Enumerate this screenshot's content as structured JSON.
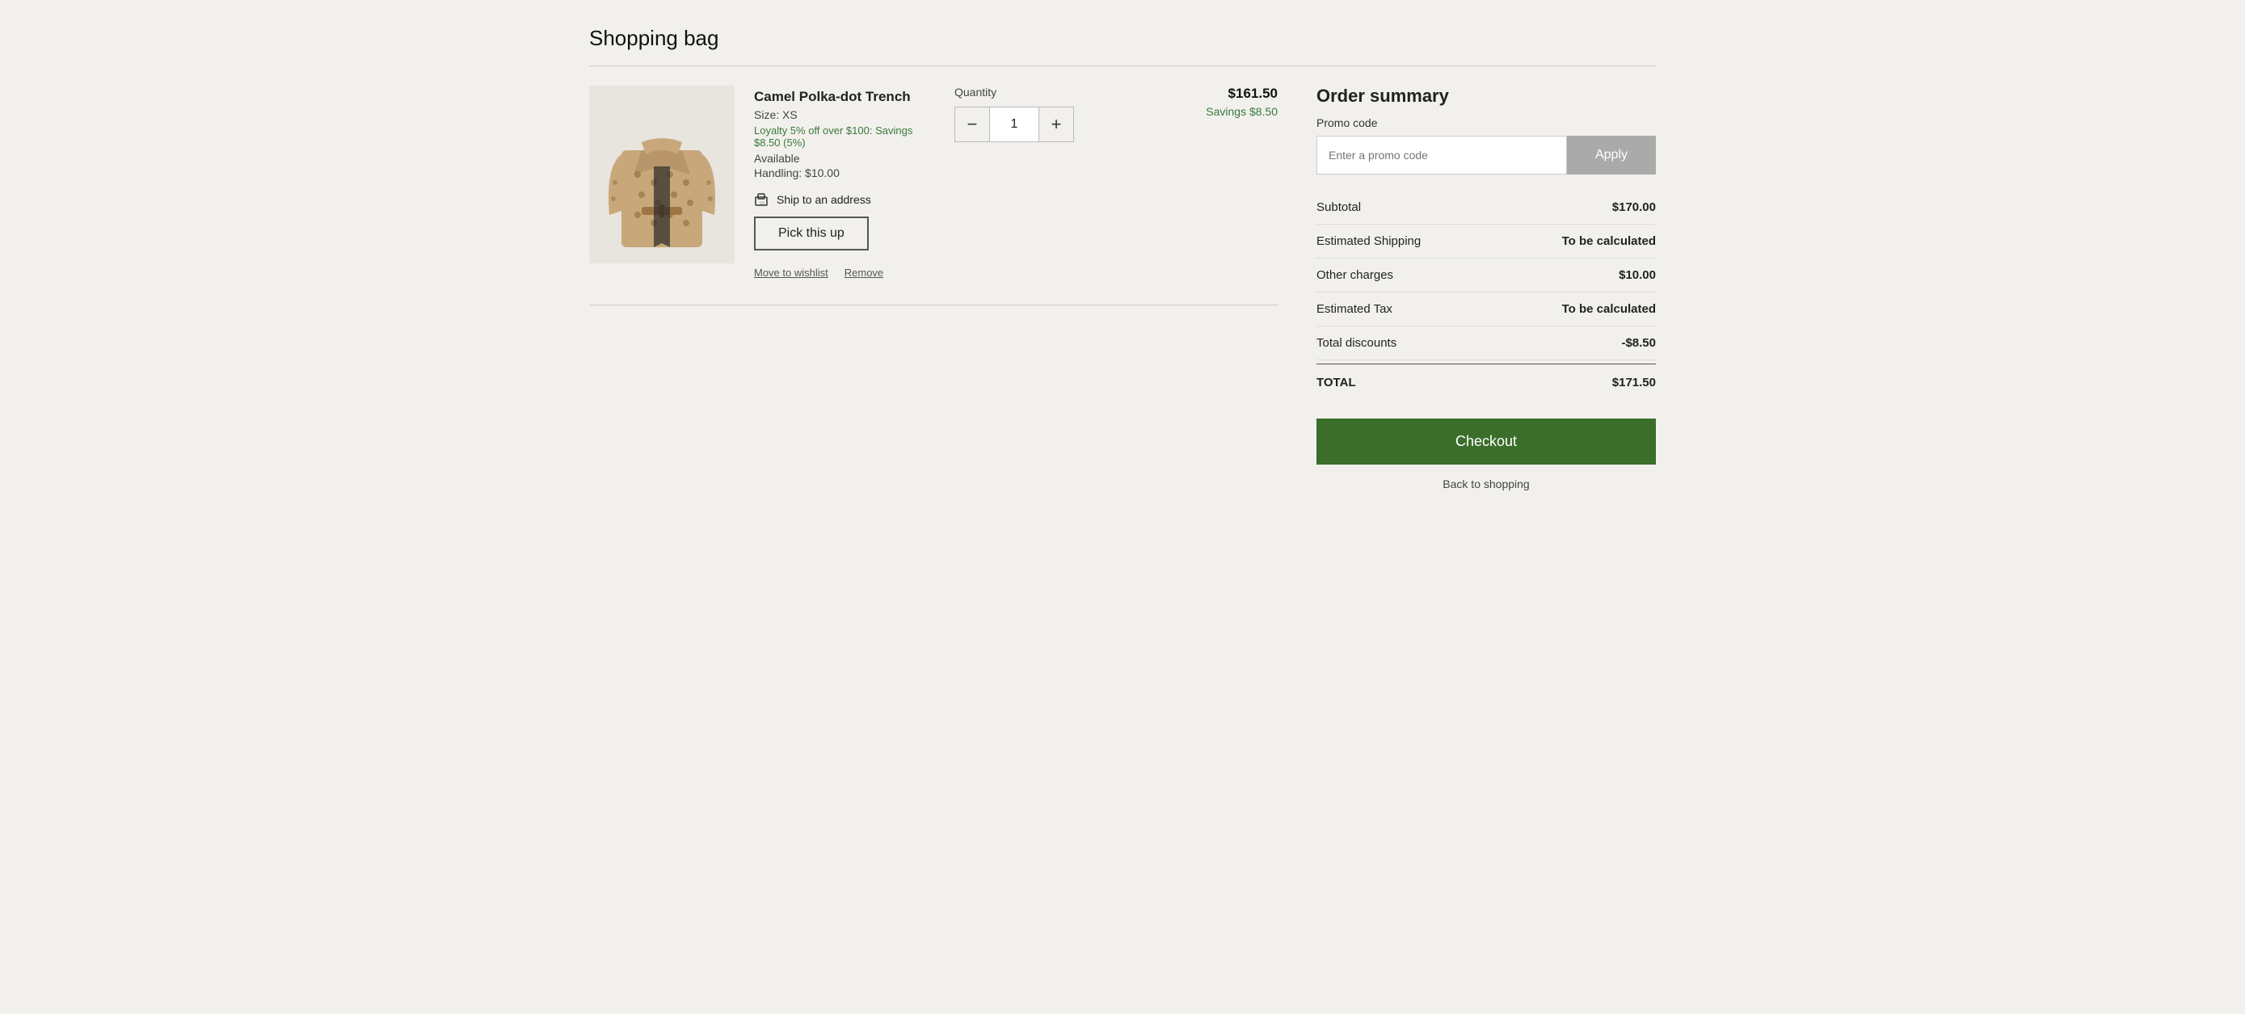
{
  "page": {
    "title": "Shopping bag"
  },
  "cart": {
    "items": [
      {
        "name": "Camel Polka-dot Trench",
        "size": "Size: XS",
        "loyalty": "Loyalty 5% off over $100: Savings $8.50 (5%)",
        "availability": "Available",
        "handling": "Handling: $10.00",
        "ship_label": "Ship to an address",
        "pick_up_label": "Pick this up",
        "quantity": 1,
        "quantity_label": "Quantity",
        "price": "$161.50",
        "savings": "Savings $8.50",
        "move_to_wishlist": "Move to wishlist",
        "remove": "Remove"
      }
    ]
  },
  "order_summary": {
    "title": "Order summary",
    "promo_label": "Promo code",
    "promo_placeholder": "Enter a promo code",
    "apply_label": "Apply",
    "rows": [
      {
        "label": "Subtotal",
        "value": "$170.00",
        "bold": true
      },
      {
        "label": "Estimated Shipping",
        "value": "To be calculated",
        "bold": true
      },
      {
        "label": "Other charges",
        "value": "$10.00",
        "bold": true
      },
      {
        "label": "Estimated Tax",
        "value": "To be calculated",
        "bold": true
      },
      {
        "label": "Total discounts",
        "value": "-$8.50",
        "bold": false
      }
    ],
    "total_label": "TOTAL",
    "total_value": "$171.50",
    "checkout_label": "Checkout",
    "back_label": "Back to shopping"
  }
}
